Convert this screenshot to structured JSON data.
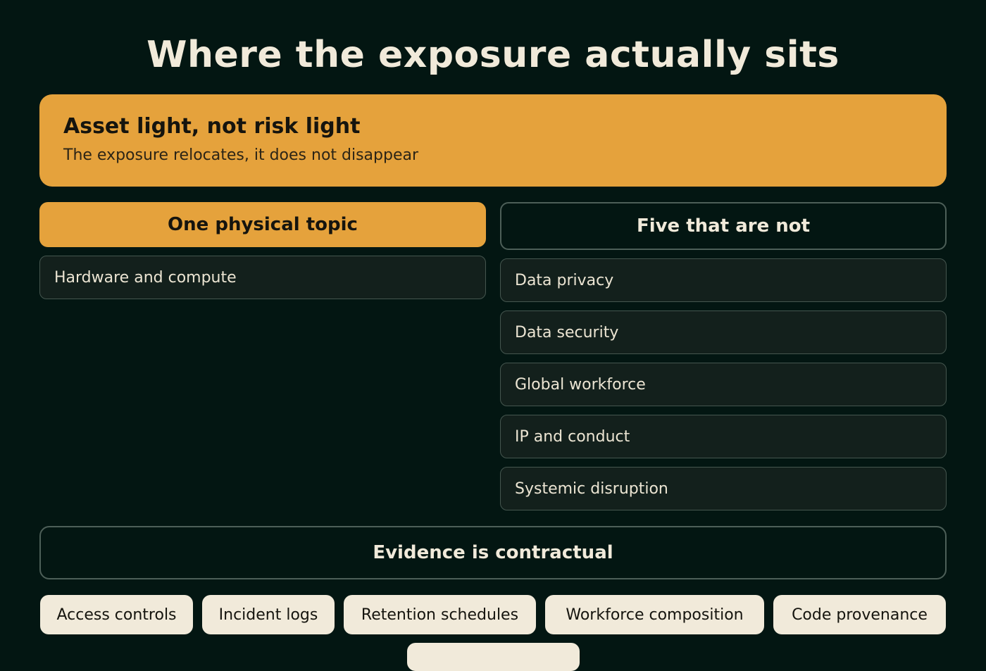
{
  "title": "Where the exposure actually sits",
  "banner": {
    "title": "Asset light, not risk light",
    "subtitle": "The exposure relocates, it does not disappear"
  },
  "left_column": {
    "heading": "One physical topic",
    "items": [
      "Hardware and compute"
    ]
  },
  "right_column": {
    "heading": "Five that are not",
    "items": [
      "Data privacy",
      "Data security",
      "Global workforce",
      "IP and conduct",
      "Systemic disruption"
    ]
  },
  "evidence": {
    "heading": "Evidence is contractual",
    "chips": [
      "Access controls",
      "Incident logs",
      "Retention schedules",
      "Workforce composition",
      "Code provenance"
    ]
  },
  "colors": {
    "background": "#031612",
    "accent": "#e5a23c",
    "cream": "#f1eada",
    "card": "#13201c",
    "border": "#4d5f58"
  }
}
